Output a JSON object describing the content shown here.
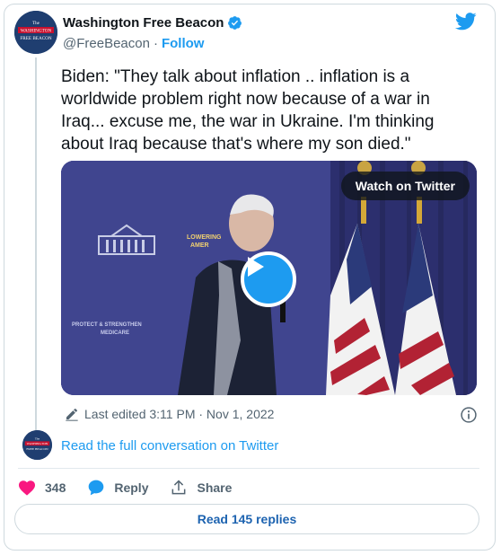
{
  "author": {
    "name": "Washington Free Beacon",
    "handle": "@FreeBeacon",
    "separator": "·",
    "follow_label": "Follow",
    "avatar_text_top": "The",
    "avatar_text_line1": "WASHINGTON",
    "avatar_text_line2": "FREE BEACON"
  },
  "tweet": {
    "text": "Biden: \"They talk about inflation .. inflation is a worldwide problem right now because of a war in Iraq... excuse me, the war in Ukraine. I'm thinking about Iraq because that's where my son died.\""
  },
  "media": {
    "watch_label": "Watch on Twitter",
    "banner_text_1": "LOWERING",
    "banner_text_2": "AMER",
    "podium_text": "PROTECT & STRENGTHEN",
    "podium_text_2": "MEDICARE"
  },
  "meta": {
    "edited_label": "Last edited 3:11 PM · Nov 1, 2022"
  },
  "conversation": {
    "label": "Read the full conversation on Twitter"
  },
  "actions": {
    "like_count": "348",
    "reply_label": "Reply",
    "share_label": "Share"
  },
  "replies_button": {
    "label": "Read 145 replies"
  },
  "colors": {
    "accent": "#1d9bf0",
    "like": "#f91880",
    "text": "#0f1419",
    "muted": "#536471"
  }
}
